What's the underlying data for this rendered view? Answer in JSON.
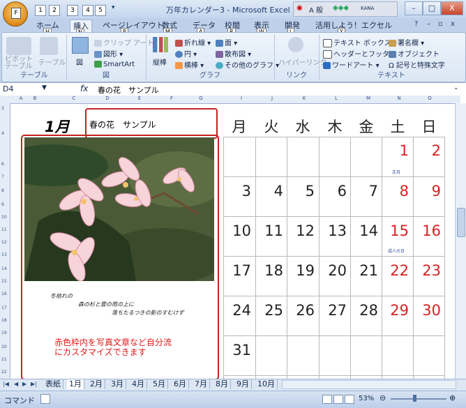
{
  "window": {
    "title": "万年カレンダー3 - Microsoft Excel",
    "tray_text": "A 般",
    "tray_ime": "KANA",
    "minimize": "–",
    "maximize": "□",
    "close": "X"
  },
  "office_button_key": "F",
  "qat_keys": [
    "1",
    "2",
    "3",
    "4",
    "5"
  ],
  "ribbon_tabs": [
    {
      "label": "ホーム",
      "key": "H"
    },
    {
      "label": "挿入",
      "key": "N"
    },
    {
      "label": "ページレイアウト",
      "key": "P"
    },
    {
      "label": "数式",
      "key": "M"
    },
    {
      "label": "データ",
      "key": "A"
    },
    {
      "label": "校閲",
      "key": "R"
    },
    {
      "label": "表示",
      "key": "W"
    },
    {
      "label": "開発",
      "key": "L"
    },
    {
      "label": "活用しよう！エクセル",
      "key": "Y"
    }
  ],
  "ribbon_right_icons": {
    "help": "?",
    "min": "–",
    "restore": "▫",
    "close": "x"
  },
  "ribbon": {
    "table_group": {
      "label": "テーブル",
      "pivot": "ピボット\nテーブル",
      "table": "テーブル"
    },
    "illust_group": {
      "label": "図",
      "picture": "図",
      "clipart": "クリップ アート",
      "shapes": "図形",
      "smartart": "SmartArt"
    },
    "chart_group": {
      "label": "グラフ",
      "column": "縦棒",
      "line": "折れ線",
      "pie": "円",
      "bar": "横棒",
      "area": "面",
      "scatter": "散布図",
      "other": "その他のグラフ"
    },
    "link_group": {
      "label": "リンク",
      "hyperlink": "ハイパーリンク"
    },
    "text_group": {
      "label": "テキスト",
      "textbox": "テキスト ボックス",
      "header": "ヘッダーとフッター",
      "wordart": "ワードアート",
      "signature": "署名欄",
      "object": "オブジェクト",
      "symbol": "記号と特殊文字"
    }
  },
  "formula_bar": {
    "name_box": "D4",
    "fx": "fx",
    "content": "春の花　サンプル"
  },
  "columns": [
    "A",
    "B",
    "C",
    "D",
    "E",
    "F",
    "G",
    "I",
    "J",
    "K",
    "L",
    "M",
    "N",
    "O"
  ],
  "rows": [
    "3",
    "4",
    "6",
    "7",
    "8",
    "9",
    "10",
    "11",
    "12",
    "13",
    "14",
    "15",
    "16",
    "17",
    "18",
    "19",
    "20",
    "21",
    "22"
  ],
  "calendar": {
    "month": "1月",
    "title": "春の花　サンプル",
    "weekdays": [
      "月",
      "火",
      "水",
      "木",
      "金",
      "土",
      "日"
    ],
    "weeks": [
      [
        "",
        "",
        "",
        "",
        "",
        "1",
        "2"
      ],
      [
        "3",
        "4",
        "5",
        "6",
        "7",
        "8",
        "9"
      ],
      [
        "10",
        "11",
        "12",
        "13",
        "14",
        "15",
        "16"
      ],
      [
        "17",
        "18",
        "19",
        "20",
        "21",
        "22",
        "23"
      ],
      [
        "24",
        "25",
        "26",
        "27",
        "28",
        "29",
        "30"
      ],
      [
        "31",
        "",
        "",
        "",
        "",
        "",
        ""
      ]
    ],
    "holidays": [
      {
        "label": "正月"
      },
      {
        "label": "成人の日"
      }
    ],
    "poem": [
      "冬枯れの",
      "森の杉と雲の雨の上に",
      "落ちたるつきの影のすむけず"
    ],
    "note": [
      "赤色枠内を写真文章など自分流",
      "にカスタマイズできます"
    ]
  },
  "sheet_tabs": [
    "表紙",
    "1月",
    "2月",
    "3月",
    "4月",
    "5月",
    "6月",
    "7月",
    "8月",
    "9月",
    "10月"
  ],
  "active_sheet": "1月",
  "status": {
    "mode": "コマンド",
    "zoom": "53%"
  },
  "colors": {
    "accent": "#c82020",
    "holiday_red": "#d42323",
    "ribbon_blue": "#c3d3e8"
  }
}
